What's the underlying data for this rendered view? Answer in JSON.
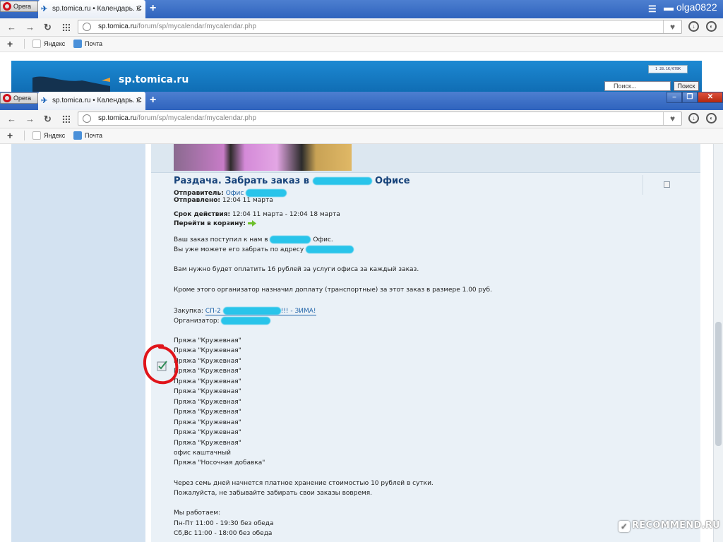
{
  "browser_back": {
    "logo_label": "Opera",
    "tab_title": "sp.tomica.ru • Календарь. С",
    "user_name": "olga0822",
    "url_host": "sp.tomica.ru",
    "url_path": "/forum/sp/mycalendar/mycalendar.php",
    "bookmarks": [
      "Яндекс",
      "Почта"
    ]
  },
  "background_site": {
    "site_name": "sp.tomica.ru",
    "counter_text": "1 28.1K/678K",
    "search_placeholder": "Поиск...",
    "search_button": "Поиск"
  },
  "browser_front": {
    "logo_label": "Opera",
    "tab_title": "sp.tomica.ru • Календарь. С",
    "url_host": "sp.tomica.ru",
    "url_path": "/forum/sp/mycalendar/mycalendar.php",
    "bookmarks": [
      "Яндекс",
      "Почта"
    ]
  },
  "message": {
    "title_pre": "Раздача. Забрать заказ в",
    "title_post": "Офисе",
    "sender_label": "Отправитель:",
    "sender_value": "Офис",
    "sent_label": "Отправлено:",
    "sent_value": "12:04 11 марта",
    "valid_label": "Срок действия:",
    "valid_value": "12:04 11 марта - 12:04 18 марта",
    "cart_label": "Перейти в корзину:",
    "body_1a": "Ваш заказ поступил к нам в",
    "body_1b": "Офис.",
    "body_2": "Вы уже можете его забрать по адресу",
    "body_3": "Вам нужно будет оплатить 16 рублей за услуги офиса за каждый заказ.",
    "body_4": "Кроме этого организатор назначил доплату (транспортные) за этот заказ в размере 1.00 руб.",
    "purchase_label": "Закупка:",
    "purchase_pre": "СП-2",
    "purchase_post": "!!! - ЗИМА!",
    "organizer_label": "Организатор:",
    "items": [
      "Пряжа \"Кружевная\"",
      "Пряжа \"Кружевная\"",
      "Пряжа \"Кружевная\"",
      "Пряжа \"Кружевная\"",
      "Пряжа \"Кружевная\"",
      "Пряжа \"Кружевная\"",
      "Пряжа \"Кружевная\"",
      "Пряжа \"Кружевная\"",
      "Пряжа \"Кружевная\"",
      "Пряжа \"Кружевная\"",
      "Пряжа \"Кружевная\"",
      "офис каштачный",
      "Пряжа \"Носочная добавка\""
    ],
    "storage_1": "Через семь дней начнется платное хранение стоимостью 10 рублей в сутки.",
    "storage_2": "Пожалуйста, не забывайте забирать свои заказы вовремя.",
    "hours_title": "Мы работаем:",
    "hours_1": "Пн-Пт 11:00 - 19:30 без обеда",
    "hours_2": "Сб,Вс 11:00 - 18:00 без обеда"
  },
  "watermark": "RECOMMEND.RU",
  "colors": {
    "tabbar": "#2f63bd",
    "site_banner": "#1d89d2",
    "sidebar": "#d3e2f1",
    "content_bg": "#eaf1f7",
    "title": "#17437a",
    "link": "#1f63a8",
    "redaction": "#29c4ea",
    "annotation": "#e0141a"
  }
}
